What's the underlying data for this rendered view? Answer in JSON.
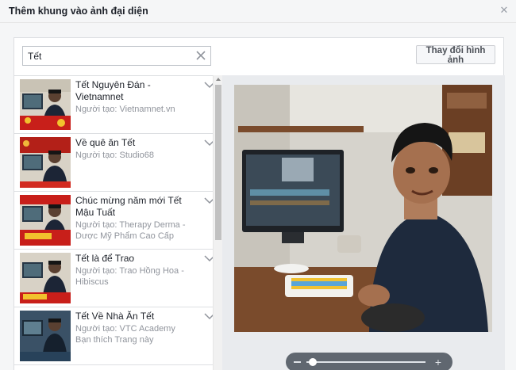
{
  "dialog": {
    "title": "Thêm khung vào ảnh đại diện",
    "close_icon": "close-icon"
  },
  "search": {
    "value": "Tết",
    "placeholder": ""
  },
  "change_photo_label": "Thay đổi hình ảnh",
  "frames": [
    {
      "title": "Tết Nguyên Đán - Vietnamnet",
      "creator": "Người tạo: Vietnamnet.vn"
    },
    {
      "title": "Về quê ăn Tết",
      "creator": "Người tạo: Studio68"
    },
    {
      "title": "Chúc mừng năm mới Tết Mậu Tuất",
      "creator": "Người tạo: Therapy Derma - Dược Mỹ Phẩm Cao Cấp"
    },
    {
      "title": "Tết là để Trao",
      "creator": "Người tạo: Trao Hồng Hoa - Hibiscus"
    },
    {
      "title": "Tết Về Nhà Ăn Tết",
      "creator": "Người tạo: VTC Academy",
      "extra": "Bạn thích Trang này"
    }
  ],
  "zoom": {
    "level": 0.05,
    "minus_icon": "minus-icon",
    "plus_icon": "plus-icon",
    "plus_glyph": "+"
  },
  "colors": {
    "accent": "#4267b2",
    "text_primary": "#1d2129",
    "text_secondary": "#90949c"
  }
}
